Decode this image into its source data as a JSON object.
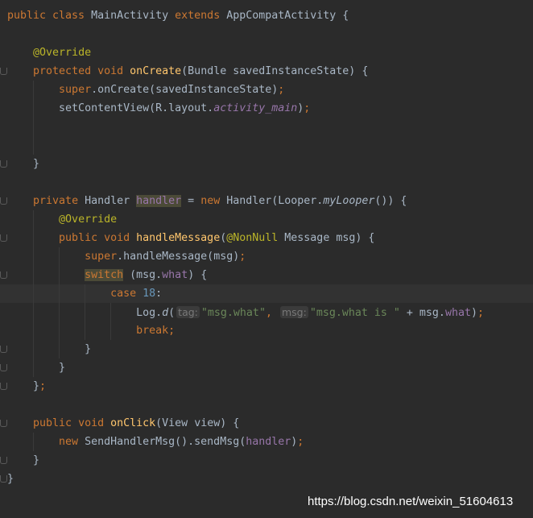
{
  "code": {
    "current_line": 15,
    "lines": [
      {
        "fold": false,
        "tokens": [
          {
            "t": "public class ",
            "c": "kw"
          },
          {
            "t": "MainActivity ",
            "c": ""
          },
          {
            "t": "extends ",
            "c": "kw"
          },
          {
            "t": "AppCompatActivity {",
            "c": ""
          }
        ]
      },
      {
        "fold": false,
        "tokens": []
      },
      {
        "fold": false,
        "tokens": [
          {
            "t": "    ",
            "c": ""
          },
          {
            "t": "@Override",
            "c": "ann"
          }
        ]
      },
      {
        "fold": true,
        "tokens": [
          {
            "t": "    ",
            "c": ""
          },
          {
            "t": "protected void ",
            "c": "kw"
          },
          {
            "t": "onCreate",
            "c": "fn"
          },
          {
            "t": "(Bundle savedInstanceState) {",
            "c": ""
          }
        ]
      },
      {
        "fold": false,
        "tokens": [
          {
            "t": "        ",
            "c": ""
          },
          {
            "t": "super",
            "c": "kw"
          },
          {
            "t": ".onCreate(savedInstanceState)",
            "c": ""
          },
          {
            "t": ";",
            "c": "kw"
          }
        ]
      },
      {
        "fold": false,
        "tokens": [
          {
            "t": "        setContentView(R.layout.",
            "c": ""
          },
          {
            "t": "activity_main",
            "c": "fieldi"
          },
          {
            "t": ")",
            "c": ""
          },
          {
            "t": ";",
            "c": "kw"
          }
        ]
      },
      {
        "fold": false,
        "tokens": []
      },
      {
        "fold": false,
        "tokens": []
      },
      {
        "fold": true,
        "tokens": [
          {
            "t": "    }",
            "c": ""
          }
        ]
      },
      {
        "fold": false,
        "tokens": []
      },
      {
        "fold": true,
        "tokens": [
          {
            "t": "    ",
            "c": ""
          },
          {
            "t": "private ",
            "c": "kw"
          },
          {
            "t": "Handler ",
            "c": ""
          },
          {
            "t": "handler",
            "c": "field hl"
          },
          {
            "t": " = ",
            "c": ""
          },
          {
            "t": "new ",
            "c": "kw"
          },
          {
            "t": "Handler(Looper.",
            "c": ""
          },
          {
            "t": "myLooper",
            "c": "it"
          },
          {
            "t": "()) {",
            "c": ""
          }
        ]
      },
      {
        "fold": false,
        "tokens": [
          {
            "t": "        ",
            "c": ""
          },
          {
            "t": "@Override",
            "c": "ann"
          }
        ]
      },
      {
        "fold": true,
        "tokens": [
          {
            "t": "        ",
            "c": ""
          },
          {
            "t": "public void ",
            "c": "kw"
          },
          {
            "t": "handleMessage",
            "c": "fn"
          },
          {
            "t": "(",
            "c": ""
          },
          {
            "t": "@NonNull ",
            "c": "ann"
          },
          {
            "t": "Message msg) {",
            "c": ""
          }
        ]
      },
      {
        "fold": false,
        "tokens": [
          {
            "t": "            ",
            "c": ""
          },
          {
            "t": "super",
            "c": "kw"
          },
          {
            "t": ".handleMessage(msg)",
            "c": ""
          },
          {
            "t": ";",
            "c": "kw"
          }
        ]
      },
      {
        "fold": true,
        "tokens": [
          {
            "t": "            ",
            "c": ""
          },
          {
            "t": "switch",
            "c": "kw hl"
          },
          {
            "t": " (msg.",
            "c": ""
          },
          {
            "t": "what",
            "c": "field"
          },
          {
            "t": ") {",
            "c": ""
          }
        ]
      },
      {
        "fold": false,
        "tokens": [
          {
            "t": "                ",
            "c": ""
          },
          {
            "t": "case ",
            "c": "kw"
          },
          {
            "t": "18",
            "c": "num"
          },
          {
            "t": ":",
            "c": ""
          }
        ]
      },
      {
        "fold": false,
        "tokens": [
          {
            "t": "                    Log.",
            "c": ""
          },
          {
            "t": "d",
            "c": "it"
          },
          {
            "t": "(",
            "c": ""
          },
          {
            "t": "tag:",
            "c": "hint"
          },
          {
            "t": "\"msg.what\"",
            "c": "str"
          },
          {
            "t": ", ",
            "c": "kw"
          },
          {
            "t": "msg:",
            "c": "hint"
          },
          {
            "t": "\"msg.what is \" ",
            "c": "str"
          },
          {
            "t": "+ msg.",
            "c": ""
          },
          {
            "t": "what",
            "c": "field"
          },
          {
            "t": ")",
            "c": ""
          },
          {
            "t": ";",
            "c": "kw"
          }
        ]
      },
      {
        "fold": false,
        "tokens": [
          {
            "t": "                    ",
            "c": ""
          },
          {
            "t": "break;",
            "c": "kw"
          }
        ]
      },
      {
        "fold": true,
        "tokens": [
          {
            "t": "            }",
            "c": ""
          }
        ]
      },
      {
        "fold": true,
        "tokens": [
          {
            "t": "        }",
            "c": ""
          }
        ]
      },
      {
        "fold": true,
        "tokens": [
          {
            "t": "    }",
            "c": ""
          },
          {
            "t": ";",
            "c": "kw"
          }
        ]
      },
      {
        "fold": false,
        "tokens": []
      },
      {
        "fold": true,
        "tokens": [
          {
            "t": "    ",
            "c": ""
          },
          {
            "t": "public void ",
            "c": "kw"
          },
          {
            "t": "onClick",
            "c": "fn"
          },
          {
            "t": "(View view) {",
            "c": ""
          }
        ]
      },
      {
        "fold": false,
        "tokens": [
          {
            "t": "        ",
            "c": ""
          },
          {
            "t": "new ",
            "c": "kw"
          },
          {
            "t": "SendHandlerMsg().sendMsg(",
            "c": ""
          },
          {
            "t": "handler",
            "c": "field"
          },
          {
            "t": ")",
            "c": ""
          },
          {
            "t": ";",
            "c": "kw"
          }
        ]
      },
      {
        "fold": true,
        "tokens": [
          {
            "t": "    }",
            "c": ""
          }
        ]
      },
      {
        "fold": true,
        "tokens": [
          {
            "t": "}",
            "c": ""
          }
        ]
      }
    ]
  },
  "colors": {
    "background": "#2b2b2b",
    "keyword": "#cc7832",
    "method": "#ffc66d",
    "annotation": "#bbb529",
    "field": "#9876aa",
    "number": "#6897bb",
    "string": "#6a8759"
  },
  "watermark": "https://blog.csdn.net/weixin_51604613"
}
